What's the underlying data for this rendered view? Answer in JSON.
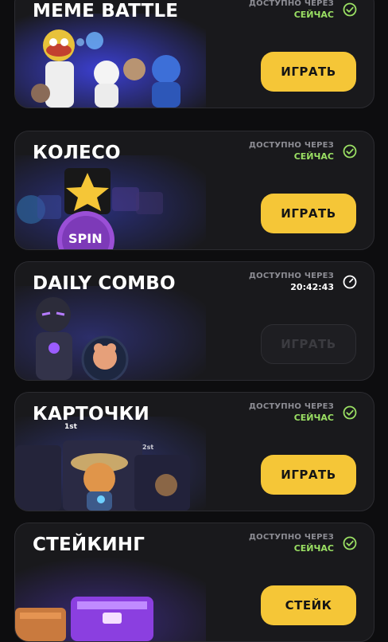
{
  "cards": [
    {
      "title": "MEME BATTLE",
      "status_label": "ДОСТУПНО ЧЕРЕЗ",
      "status_value": "СЕЙЧАС",
      "status_state": "available",
      "button": "ИГРАТЬ"
    },
    {
      "title": "КОЛЕСО",
      "status_label": "ДОСТУПНО ЧЕРЕЗ",
      "status_value": "СЕЙЧАС",
      "status_state": "available",
      "button": "ИГРАТЬ",
      "spin_label": "SPIN"
    },
    {
      "title": "DAILY COMBO",
      "status_label": "ДОСТУПНО ЧЕРЕЗ",
      "status_value": "20:42:43",
      "status_state": "timer",
      "button": "ИГРАТЬ"
    },
    {
      "title": "КАРТОЧКИ",
      "status_label": "ДОСТУПНО ЧЕРЕЗ",
      "status_value": "СЕЙЧАС",
      "status_state": "available",
      "button": "ИГРАТЬ",
      "rank_1": "1st",
      "rank_2": "2st"
    },
    {
      "title": "СТЕЙКИНГ",
      "status_label": "ДОСТУПНО ЧЕРЕЗ",
      "status_value": "СЕЙЧАС",
      "status_state": "available",
      "button": "СТЕЙК"
    }
  ],
  "colors": {
    "accent_button": "#f5c637",
    "available_green": "#9adf63",
    "card_bg": "#19191c",
    "page_bg": "#0d0d0f"
  },
  "icons": [
    "check-circle-icon",
    "clock-icon"
  ]
}
